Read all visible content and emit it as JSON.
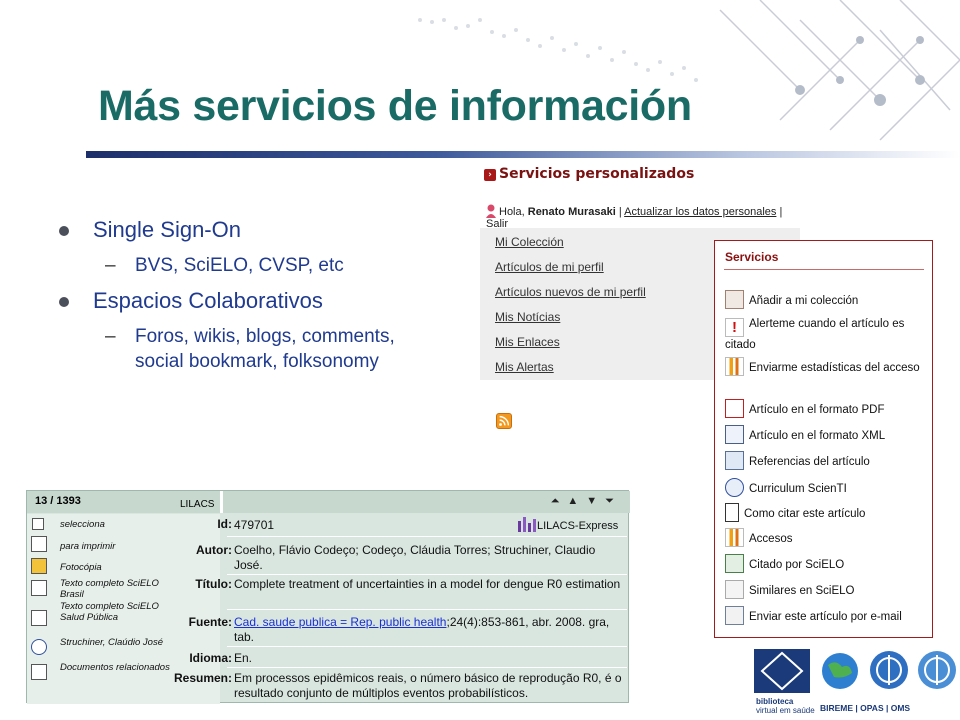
{
  "slide": {
    "title": "Más servicios de información",
    "bullets": [
      {
        "text": "Single Sign-On",
        "sub": [
          "BVS, SciELO, CVSP, etc"
        ]
      },
      {
        "text": "Espacios Colaborativos",
        "sub": [
          "Foros, wikis, blogs, comments, social bookmark, folksonomy"
        ]
      }
    ]
  },
  "personalized": {
    "heading": "Servicios personalizados",
    "greeting": "Hola, ",
    "user": "Renato Murasaki",
    "sep1": " | ",
    "update_link": "Actualizar los datos personales",
    "sep2": " | ",
    "logout_link": "Salir",
    "menu": [
      "Mi Colección",
      "Artículos de mi perfil",
      "Artículos nuevos de mi perfil",
      "Mis Notícias",
      "Mis Enlaces",
      "Mis Alertas"
    ]
  },
  "services": {
    "title": "Servicios",
    "items": [
      {
        "icon": "folder-icon",
        "label": "Añadir a mi colección"
      },
      {
        "icon": "alert-icon",
        "label": "Alerteme cuando el artículo es citado"
      },
      {
        "icon": "bar-chart-icon",
        "label": "Enviarme estadísticas del acceso"
      },
      {
        "icon": "pdf-icon",
        "label": "Artículo en el formato PDF"
      },
      {
        "icon": "xml-icon",
        "label": "Artículo en el formato XML"
      },
      {
        "icon": "references-icon",
        "label": "Referencias del artículo"
      },
      {
        "icon": "curriculum-icon",
        "label": "Curriculum ScienTI"
      },
      {
        "icon": "cite-icon",
        "label": "Como citar este artículo"
      },
      {
        "icon": "access-chart-icon",
        "label": "Accesos"
      },
      {
        "icon": "cited-icon",
        "label": "Citado por SciELO"
      },
      {
        "icon": "similar-icon",
        "label": "Similares en SciELO"
      },
      {
        "icon": "email-icon",
        "label": "Enviar este artículo por e-mail"
      }
    ]
  },
  "record": {
    "count": "13 / 1393",
    "source": "LILACS",
    "express_label": "LILACS-Express",
    "left_actions": [
      {
        "icon": "checkbox-icon",
        "label": "selecciona"
      },
      {
        "icon": "print-icon",
        "label": "para imprimir"
      },
      {
        "icon": "fotocopia-icon",
        "label": "Fotocópia"
      },
      {
        "icon": "fulltext-icon",
        "label": "Texto completo SciELO Brasil"
      },
      {
        "icon": "fulltext-icon",
        "label": "Texto completo SciELO Salud Pública"
      },
      {
        "icon": "curriculum-icon",
        "label": "Struchiner, Claúdio José"
      },
      {
        "icon": "documents-icon",
        "label": "Documentos relacionados"
      }
    ],
    "fields": [
      {
        "label": "Id:",
        "value": "479701"
      },
      {
        "label": "Autor:",
        "value": "Coelho, Flávio Codeço; Codeço, Cláudia Torres; Struchiner, Claudio José."
      },
      {
        "label": "Título:",
        "value": "Complete treatment of uncertainties in a model for dengue R0 estimation"
      },
      {
        "label": "Fuente:",
        "link": "Cad. saude publica = Rep. public health",
        "value": ";24(4):853-861, abr. 2008. gra, tab."
      },
      {
        "label": "Idioma:",
        "value": "En."
      },
      {
        "label": "Resumen:",
        "value": "Em processos epidêmicos reais, o número básico de reprodução R0, é o resultado conjunto de múltiplos eventos probabilísticos."
      }
    ]
  },
  "logos": {
    "bvs_line1": "biblioteca",
    "bvs_line2": "virtual em saúde",
    "orgs": "BIREME | OPAS | OMS"
  },
  "colors": {
    "title": "#1a6b66",
    "bullet_text": "#1f3a8f",
    "services_border": "#a01c1c"
  }
}
